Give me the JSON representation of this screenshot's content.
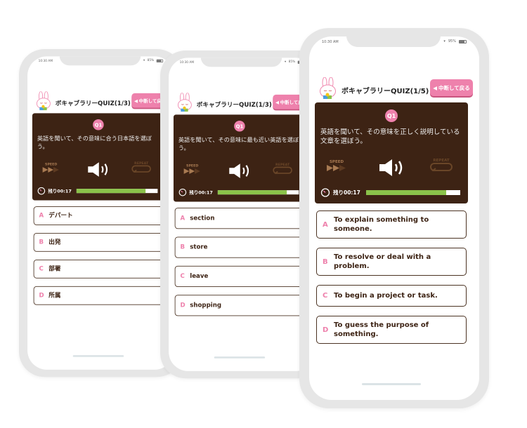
{
  "colors": {
    "accent": "#ee81ac",
    "card": "#3d2314",
    "progress": "#8bc34a",
    "frame": "#e6e6e6"
  },
  "phones": [
    {
      "status": {
        "time": "10:30 AM",
        "battery": "85%"
      },
      "header": {
        "title": "ボキャブラリーQUIZ(1/3)",
        "quit_label": "中断して戻る"
      },
      "question": {
        "badge": "Q1",
        "text": "英語を聞いて、その意味に合う日本語を選ぼう。",
        "speed_label": "SPEED",
        "repeat_label": "REPEAT",
        "remaining": "残り00:17",
        "progress": 0.85
      },
      "options": [
        {
          "letter": "A",
          "text": "デパート"
        },
        {
          "letter": "B",
          "text": "出発"
        },
        {
          "letter": "C",
          "text": "部署"
        },
        {
          "letter": "D",
          "text": "所属"
        }
      ]
    },
    {
      "status": {
        "time": "10:30 AM",
        "battery": "85%"
      },
      "header": {
        "title": "ボキャブラリーQUIZ(1/3)",
        "quit_label": "中断して戻る"
      },
      "question": {
        "badge": "Q1",
        "text": "英語を聞いて、その意味に最も近い英語を選ぼう。",
        "speed_label": "SPEED",
        "repeat_label": "REPEAT",
        "remaining": "残り00:17",
        "progress": 0.85
      },
      "options": [
        {
          "letter": "A",
          "text": "section"
        },
        {
          "letter": "B",
          "text": "store"
        },
        {
          "letter": "C",
          "text": "leave"
        },
        {
          "letter": "D",
          "text": "shopping"
        }
      ]
    },
    {
      "status": {
        "time": "10:30 AM",
        "battery": "95%"
      },
      "header": {
        "title": "ボキャブラリーQUIZ(1/5)",
        "quit_label": "中断して戻る"
      },
      "question": {
        "badge": "Q1",
        "text": "英語を聞いて、その意味を正しく説明している文章を選ぼう。",
        "speed_label": "SPEED",
        "repeat_label": "REPEAT",
        "remaining": "残り00:17",
        "progress": 0.85
      },
      "options": [
        {
          "letter": "A",
          "text": "To explain something to someone."
        },
        {
          "letter": "B",
          "text": "To resolve or deal with a problem."
        },
        {
          "letter": "C",
          "text": "To begin a project or task."
        },
        {
          "letter": "D",
          "text": "To guess the purpose of something."
        }
      ]
    }
  ]
}
